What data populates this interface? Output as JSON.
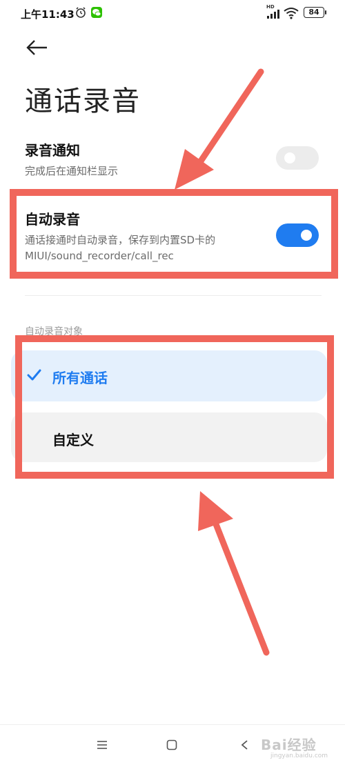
{
  "status_bar": {
    "time": "上午11:43",
    "network_badge": "HD",
    "signal_label": "4G",
    "battery": "84",
    "icons": [
      "alarm-icon",
      "wechat-icon",
      "signal-icon",
      "wifi-icon",
      "battery-icon"
    ]
  },
  "header": {
    "back_icon": "arrow-left-icon",
    "title": "通话录音"
  },
  "settings": {
    "notify": {
      "title": "录音通知",
      "subtitle": "完成后在通知栏显示",
      "enabled": false
    },
    "auto_record": {
      "title": "自动录音",
      "subtitle_line1": "通话接通时自动录音，保存到内置SD卡的",
      "subtitle_line2": "MIUI/sound_recorder/call_rec",
      "enabled": true
    }
  },
  "target_section": {
    "label": "自动录音对象",
    "options": [
      {
        "label": "所有通话",
        "selected": true
      },
      {
        "label": "自定义",
        "selected": false
      }
    ]
  },
  "nav_bar": {
    "icons": [
      "menu-icon",
      "home-icon",
      "back-icon"
    ]
  },
  "watermark": {
    "logo_text": "Bai经验",
    "url": "jingyan.baidu.com"
  },
  "colors": {
    "accent": "#1f7cf0",
    "annotation": "#f0665b",
    "selected_bg": "#e4f0fd"
  }
}
